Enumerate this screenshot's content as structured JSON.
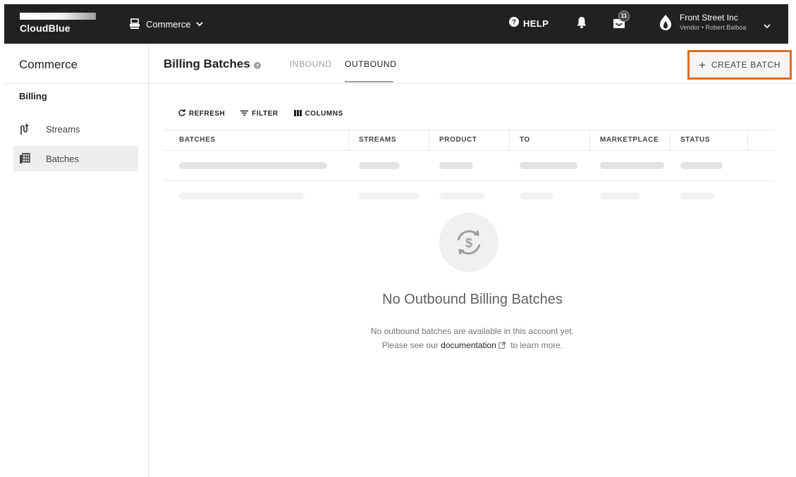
{
  "topbar": {
    "brand": "CloudBlue",
    "module": "Commerce",
    "help": "HELP",
    "notifications_badge": "11",
    "account_name": "Front Street Inc",
    "account_sub": "Vendor • Robert Balboa"
  },
  "sidebar": {
    "title": "Commerce",
    "section": "Billing",
    "items": [
      {
        "label": "Streams",
        "icon": "streams-icon",
        "active": false
      },
      {
        "label": "Batches",
        "icon": "batches-icon",
        "active": true
      }
    ]
  },
  "header": {
    "title": "Billing Batches",
    "tabs": [
      {
        "label": "INBOUND",
        "active": false
      },
      {
        "label": "OUTBOUND",
        "active": true
      }
    ],
    "create_label": "CREATE BATCH",
    "create_highlight_color": "#e06c1a"
  },
  "toolbar": {
    "refresh": "REFRESH",
    "filter": "FILTER",
    "columns": "COLUMNS"
  },
  "table": {
    "columns": [
      "BATCHES",
      "STREAMS",
      "PRODUCT",
      "TO",
      "MARKETPLACE",
      "STATUS"
    ],
    "loading": true
  },
  "empty_state": {
    "icon": "billing-sync-icon",
    "title": "No Outbound Billing Batches",
    "line1": "No outbound batches are available in this account yet.",
    "line2_before": "Please see our",
    "link": "documentation",
    "line2_after": "to learn more."
  }
}
